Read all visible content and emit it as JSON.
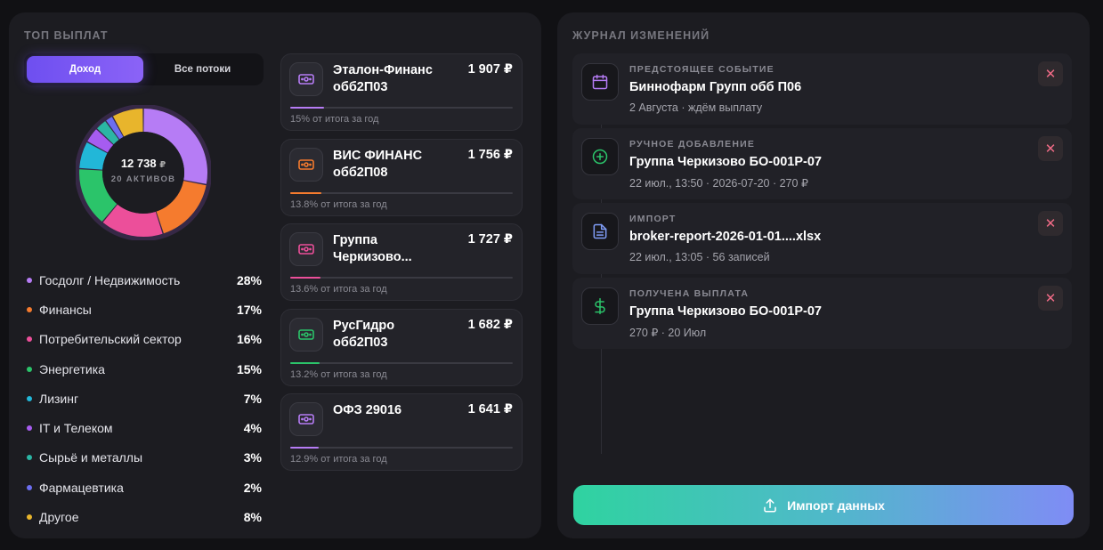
{
  "left": {
    "title": "ТОП ВЫПЛАТ",
    "toggle": {
      "active": "Доход",
      "inactive": "Все потоки"
    },
    "donut": {
      "total": "12 738",
      "currency": "₽",
      "assets": "20 АКТИВОВ"
    },
    "legend": [
      {
        "label": "Госдолг / Недвижимость",
        "pct": "28%",
        "value": 28,
        "color": "#b67cf5"
      },
      {
        "label": "Финансы",
        "pct": "17%",
        "value": 17,
        "color": "#f57b2e"
      },
      {
        "label": "Потребительский сектор",
        "pct": "16%",
        "value": 16,
        "color": "#ec4f9a"
      },
      {
        "label": "Энергетика",
        "pct": "15%",
        "value": 15,
        "color": "#2bc46a"
      },
      {
        "label": "Лизинг",
        "pct": "7%",
        "value": 7,
        "color": "#22b7d8"
      },
      {
        "label": "IT и Телеком",
        "pct": "4%",
        "value": 4,
        "color": "#a65cf0"
      },
      {
        "label": "Сырьё и металлы",
        "pct": "3%",
        "value": 3,
        "color": "#2bb6a4"
      },
      {
        "label": "Фармацевтика",
        "pct": "2%",
        "value": 2,
        "color": "#6c6ef0"
      },
      {
        "label": "Другое",
        "pct": "8%",
        "value": 8,
        "color": "#e8b52c"
      }
    ],
    "payouts": [
      {
        "name": "Эталон-Финанс обб2П03",
        "amount": "1 907 ₽",
        "share": "15% от итога за год",
        "fraction": 0.15,
        "color": "#b67cf5"
      },
      {
        "name": "ВИС ФИНАНС обб2П08",
        "amount": "1 756 ₽",
        "share": "13.8% от итога за год",
        "fraction": 0.138,
        "color": "#f57b2e"
      },
      {
        "name": "Группа Черкизово...",
        "amount": "1 727 ₽",
        "share": "13.6% от итога за год",
        "fraction": 0.136,
        "color": "#ec4f9a"
      },
      {
        "name": "РусГидро обб2П03",
        "amount": "1 682 ₽",
        "share": "13.2% от итога за год",
        "fraction": 0.132,
        "color": "#2bc46a"
      },
      {
        "name": "ОФЗ 29016",
        "amount": "1 641 ₽",
        "share": "12.9% от итога за год",
        "fraction": 0.129,
        "color": "#b67cf5"
      }
    ]
  },
  "right": {
    "title": "ЖУРНАЛ ИЗМЕНЕНИЙ",
    "events": [
      {
        "type": "ПРЕДСТОЯЩЕЕ СОБЫТИЕ",
        "title": "Биннофарм Групп обб П06",
        "meta": "2 Августа · ждём выплату",
        "icon": "calendar-icon",
        "color": "#b67cf5"
      },
      {
        "type": "РУЧНОЕ ДОБАВЛЕНИЕ",
        "title": "Группа Черкизово БО-001Р-07",
        "meta": "22 июл., 13:50 · 2026-07-20 · 270 ₽",
        "icon": "plus-circle-icon",
        "color": "#2bc46a"
      },
      {
        "type": "ИМПОРТ",
        "title": "broker-report-2026-01-01....xlsx",
        "meta": "22 июл., 13:05 · 56 записей",
        "icon": "document-icon",
        "color": "#7f9cf5"
      },
      {
        "type": "ПОЛУЧЕНА ВЫПЛАТА",
        "title": "Группа Черкизово БО-001Р-07",
        "meta": "270 ₽ · 20 Июл",
        "icon": "dollar-icon",
        "color": "#2bc46a"
      }
    ],
    "delete_label": "✕",
    "import_label": "Импорт данных"
  }
}
